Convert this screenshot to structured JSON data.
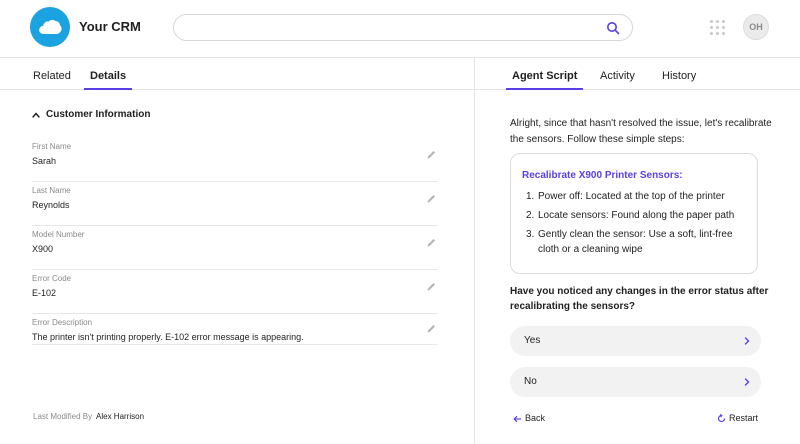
{
  "app": {
    "title": "Your CRM"
  },
  "header": {
    "search_placeholder": "",
    "avatar_initials": "OH"
  },
  "left": {
    "tabs": [
      {
        "label": "Related",
        "active": false
      },
      {
        "label": "Details",
        "active": true
      }
    ],
    "section_title": "Customer Information",
    "fields": [
      {
        "label": "First Name",
        "value": "Sarah"
      },
      {
        "label": "Last Name",
        "value": "Reynolds"
      },
      {
        "label": "Model Number",
        "value": "X900"
      },
      {
        "label": "Error Code",
        "value": "E-102"
      },
      {
        "label": "Error Description",
        "value": "The printer isn't printing properly. E-102 error message is appearing."
      }
    ],
    "last_modified_label": "Last Modified By",
    "last_modified_name": "Alex Harrison"
  },
  "right": {
    "tabs": [
      {
        "label": "Agent Script",
        "active": true
      },
      {
        "label": "Activity",
        "active": false
      },
      {
        "label": "History",
        "active": false
      }
    ],
    "intro": "Alright, since that hasn't resolved the issue, let's recalibrate the sensors. Follow these simple steps:",
    "steps_title": "Recalibrate X900 Printer Sensors:",
    "steps": [
      {
        "num": "1.",
        "text": "Power off: Located at the top of the printer"
      },
      {
        "num": "2.",
        "text": "Locate sensors: Found along the paper path"
      },
      {
        "num": "3.",
        "text": "Gently clean the sensor: Use a soft, lint-free cloth or a cleaning wipe"
      }
    ],
    "question": "Have you noticed any changes in the error status after recalibrating the sensors?",
    "answers": [
      {
        "label": "Yes"
      },
      {
        "label": "No"
      }
    ],
    "back_label": "Back",
    "restart_label": "Restart"
  },
  "colors": {
    "accent": "#5b3ee8",
    "logo": "#1ba2e0",
    "button_bg": "#f2f2f2"
  },
  "icons": {
    "logo": "cloud-icon",
    "search": "search-icon",
    "apps": "apps-grid-icon",
    "edit": "pencil-icon",
    "chevron": "chevron-right-icon",
    "collapse": "chevron-up-icon",
    "back": "arrow-left-icon",
    "restart": "restart-icon"
  }
}
